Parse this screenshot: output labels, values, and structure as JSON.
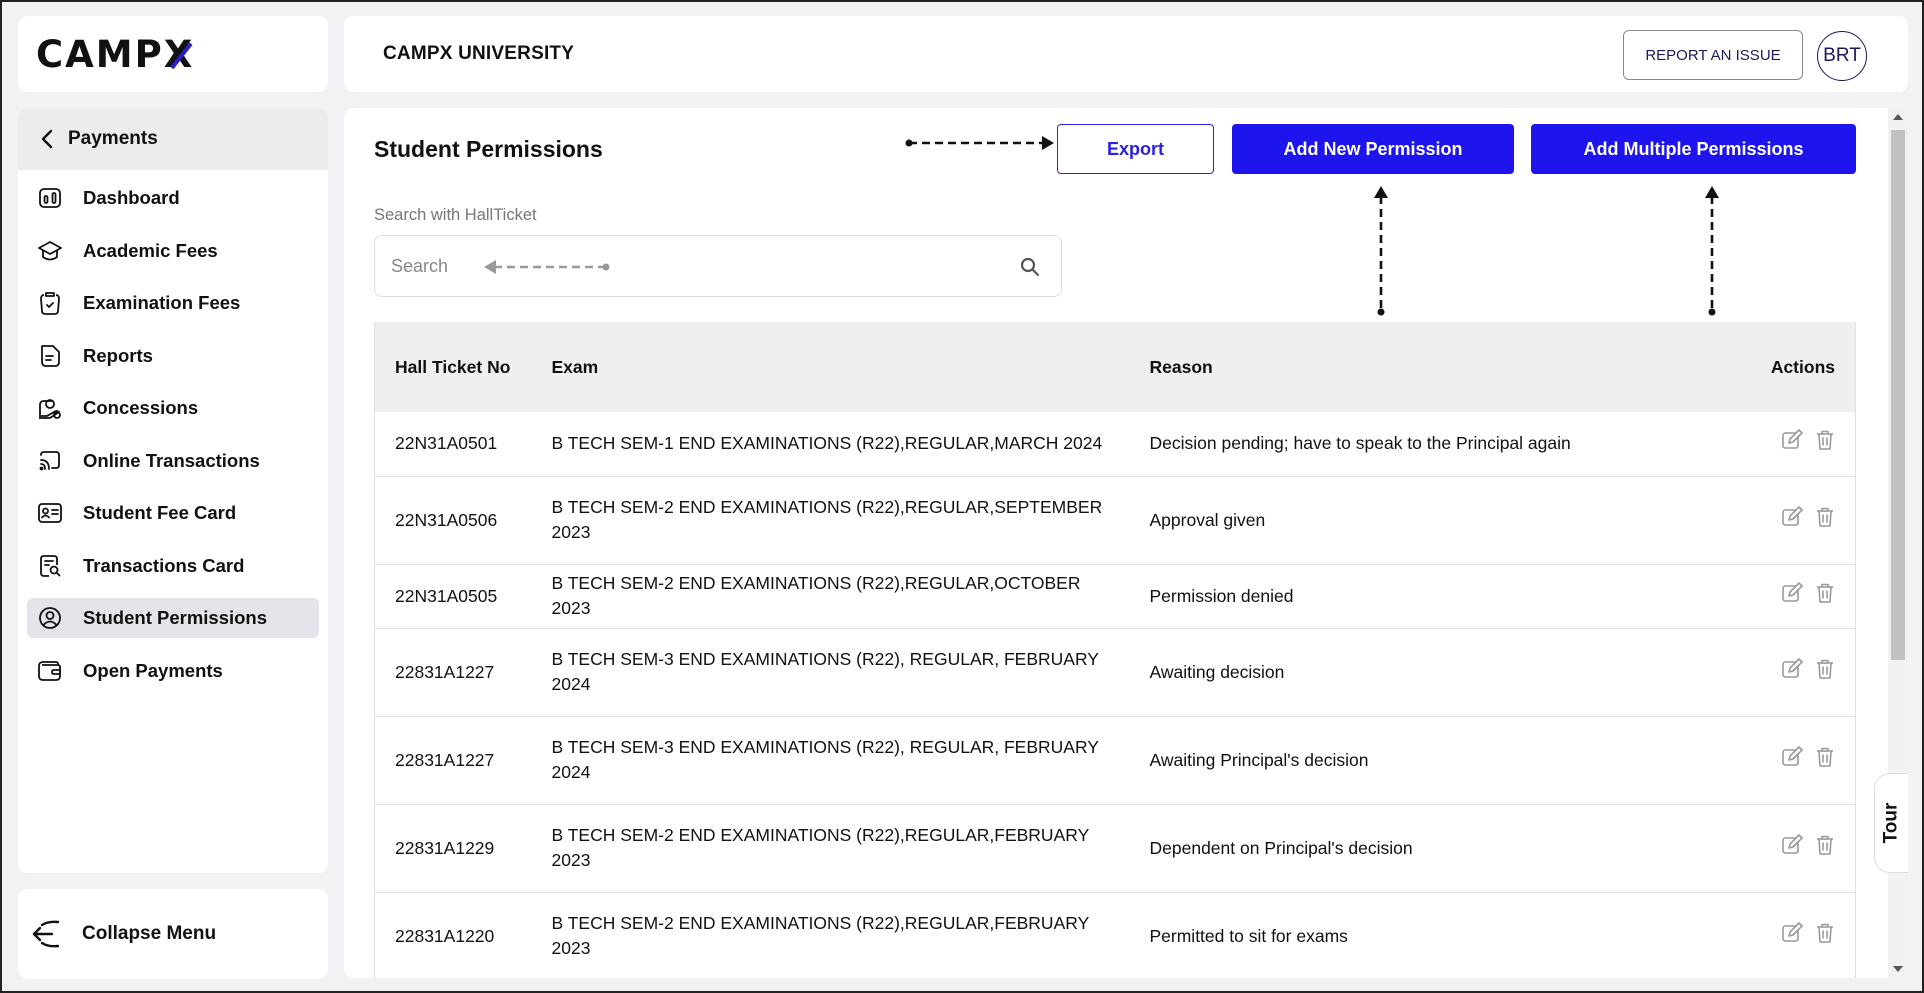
{
  "brand": {
    "logo_text": "CAMP",
    "logo_x": "X",
    "accent": "#1e14ee"
  },
  "header": {
    "university": "CAMPX UNIVERSITY",
    "report_label": "REPORT AN ISSUE",
    "avatar_initials": "BRT"
  },
  "sidebar": {
    "back_label": "Payments",
    "items": [
      {
        "label": "Dashboard",
        "icon": "dashboard-icon"
      },
      {
        "label": "Academic Fees",
        "icon": "graduation-cap-icon"
      },
      {
        "label": "Examination Fees",
        "icon": "clipboard-icon"
      },
      {
        "label": "Reports",
        "icon": "report-icon"
      },
      {
        "label": "Concessions",
        "icon": "concession-icon"
      },
      {
        "label": "Online Transactions",
        "icon": "online-transaction-icon"
      },
      {
        "label": "Student Fee Card",
        "icon": "id-card-icon"
      },
      {
        "label": "Transactions Card",
        "icon": "transactions-card-icon"
      },
      {
        "label": "Student Permissions",
        "icon": "student-permissions-icon",
        "active": true
      },
      {
        "label": "Open Payments",
        "icon": "wallet-icon"
      }
    ],
    "collapse_label": "Collapse Menu"
  },
  "main": {
    "title": "Student Permissions",
    "export_label": "Export",
    "add_label": "Add New Permission",
    "add_multi_label": "Add Multiple Permissions",
    "search_label": "Search with HallTicket",
    "search_placeholder": "Search",
    "table": {
      "headers": {
        "ht": "Hall Ticket No",
        "exam": "Exam",
        "reason": "Reason",
        "actions": "Actions"
      },
      "rows": [
        {
          "ht": "22N31A0501",
          "exam": "B TECH SEM-1 END EXAMINATIONS (R22),REGULAR,MARCH 2024",
          "reason": "Decision pending; have to speak to the Principal again"
        },
        {
          "ht": "22N31A0506",
          "exam": "B TECH SEM-2 END EXAMINATIONS (R22),REGULAR,SEPTEMBER 2023",
          "reason": "Approval given"
        },
        {
          "ht": "22N31A0505",
          "exam": "B TECH SEM-2 END EXAMINATIONS (R22),REGULAR,OCTOBER 2023",
          "reason": "Permission denied"
        },
        {
          "ht": "22831A1227",
          "exam": "B TECH SEM-3 END EXAMINATIONS (R22), REGULAR, FEBRUARY 2024",
          "reason": "Awaiting decision"
        },
        {
          "ht": "22831A1227",
          "exam": "B TECH SEM-3 END EXAMINATIONS (R22), REGULAR, FEBRUARY 2024",
          "reason": "Awaiting Principal's decision"
        },
        {
          "ht": "22831A1229",
          "exam": "B TECH SEM-2 END EXAMINATIONS (R22),REGULAR,FEBRUARY 2023",
          "reason": "Dependent on Principal's decision"
        },
        {
          "ht": "22831A1220",
          "exam": "B TECH SEM-2 END EXAMINATIONS (R22),REGULAR,FEBRUARY 2023",
          "reason": "Permitted to sit for exams"
        }
      ]
    }
  },
  "tour_label": "Tour"
}
